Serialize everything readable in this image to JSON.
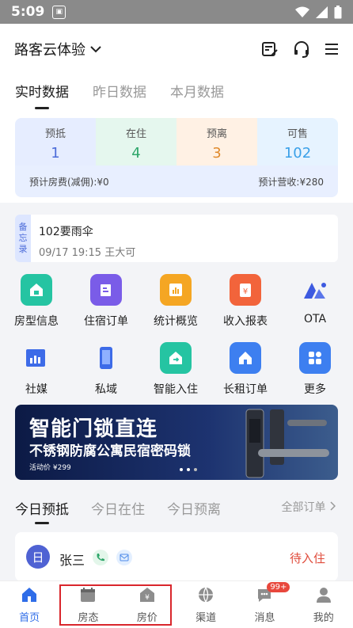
{
  "status_bar": {
    "time": "5:09",
    "app_icon": "image-icon"
  },
  "header": {
    "title": "路客云体验",
    "icons": [
      "notes-edit-icon",
      "headset-icon",
      "menu-icon"
    ]
  },
  "tabs": [
    {
      "label": "实时数据",
      "active": true
    },
    {
      "label": "昨日数据"
    },
    {
      "label": "本月数据"
    }
  ],
  "stats": [
    {
      "label": "预抵",
      "value": "1",
      "bg": "#e6edff",
      "color": "#4c6cd9"
    },
    {
      "label": "在住",
      "value": "4",
      "bg": "#e5f7ee",
      "color": "#2ea66a"
    },
    {
      "label": "预离",
      "value": "3",
      "bg": "#fff1e4",
      "color": "#e08a2c"
    },
    {
      "label": "可售",
      "value": "102",
      "bg": "#e6f3ff",
      "color": "#3aa0e8"
    }
  ],
  "fees": {
    "room_fee": "预计房费(减佣):¥0",
    "revenue": "预计营收:¥280"
  },
  "memo": {
    "tag": [
      "备",
      "忘",
      "录"
    ],
    "title": "102要雨伞",
    "meta": "09/17 19:15  王大可"
  },
  "grid": [
    {
      "label": "房型信息",
      "icon": "house-icon",
      "color": "#25c4a2"
    },
    {
      "label": "住宿订单",
      "icon": "order-doc-icon",
      "color": "#7a5ce8"
    },
    {
      "label": "统计概览",
      "icon": "bar-chart-icon",
      "color": "#f5a623"
    },
    {
      "label": "收入报表",
      "icon": "clipboard-yen-icon",
      "color": "#f2643b"
    },
    {
      "label": "OTA",
      "icon": "ota-logo-icon",
      "color": "#3d5ae0"
    },
    {
      "label": "社媒",
      "icon": "social-chart-icon",
      "color": "#3d6be8"
    },
    {
      "label": "私域",
      "icon": "phone-icon",
      "color": "#3d6be8"
    },
    {
      "label": "智能入住",
      "icon": "smart-checkin-icon",
      "color": "#25c4a2"
    },
    {
      "label": "长租订单",
      "icon": "home-icon",
      "color": "#3d7ff0"
    },
    {
      "label": "更多",
      "icon": "more-apps-icon",
      "color": "#3d7ff0"
    }
  ],
  "banner": {
    "line1": "智能门锁直连",
    "line2": "不锈钢防腐公寓民宿密码锁",
    "price": "活动价 ¥299"
  },
  "order_tabs": [
    {
      "label": "今日预抵",
      "active": true
    },
    {
      "label": "今日在住"
    },
    {
      "label": "今日预离"
    }
  ],
  "all_orders": "全部订单",
  "order": {
    "avatar": "日",
    "name": "张三",
    "status": "待入住"
  },
  "nav": [
    {
      "label": "首页",
      "icon": "home-icon",
      "active": true
    },
    {
      "label": "房态",
      "icon": "calendar-icon"
    },
    {
      "label": "房价",
      "icon": "price-tag-icon"
    },
    {
      "label": "渠道",
      "icon": "globe-icon"
    },
    {
      "label": "消息",
      "icon": "chat-icon",
      "badge": "99+"
    },
    {
      "label": "我的",
      "icon": "user-icon"
    }
  ]
}
